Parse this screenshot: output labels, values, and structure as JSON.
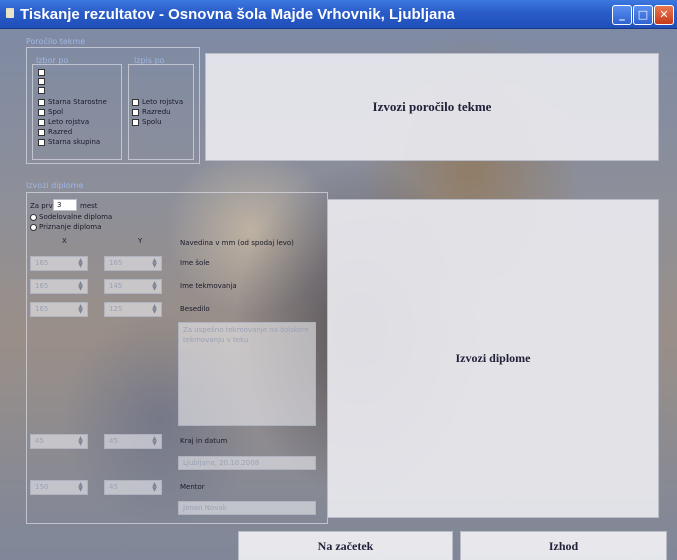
{
  "window": {
    "title": "Tiskanje rezultatov - Osnovna šola Majde Vrhovnik, Ljubljana"
  },
  "titlebar_buttons": {
    "minimize": "_",
    "maximize": "□",
    "close": "✕"
  },
  "report_group": {
    "title": "Poročilo tekme",
    "filter_title": "Izbor po",
    "filter_items": [
      "",
      "",
      "",
      "Starna Starostne",
      "Spol",
      "Leto rojstva",
      "Razred",
      "Starna skupina"
    ],
    "sort_title": "Izpis po",
    "sort_items": [
      "Leto rojstva",
      "Razredu",
      "Spolu"
    ],
    "export_button": "Izvozi poročilo tekme"
  },
  "diploma_group": {
    "title": "Izvozi diplome",
    "for_first_label": "Za prvih",
    "for_first_value": "3",
    "places_label": "mest",
    "radio_participation": "Sodelovalne diploma",
    "radio_awards": "Priznanje diploma",
    "col_x": "X",
    "col_y": "Y",
    "hint": "Navedina v mm (od spodaj levo)",
    "fields": [
      {
        "label": "Ime šole",
        "x": "165",
        "y": "165"
      },
      {
        "label": "Ime tekmovanja",
        "x": "165",
        "y": "145"
      },
      {
        "label": "Besedilo",
        "x": "165",
        "y": "125"
      }
    ],
    "text_placeholder": "Za uspešno tekmovanje na šolskem tekmovanju v teku",
    "place_date_label": "Kraj in datum",
    "place_date_x": "45",
    "place_date_y": "45",
    "place_date_value": "Ljubljana, 20.10.2008",
    "mentor_label": "Mentor",
    "mentor_x": "150",
    "mentor_y": "45",
    "mentor_value": "Jonan Novak",
    "export_button": "Izvozi diplome"
  },
  "footer": {
    "back_button": "Na začetek",
    "exit_button": "Izhod"
  }
}
